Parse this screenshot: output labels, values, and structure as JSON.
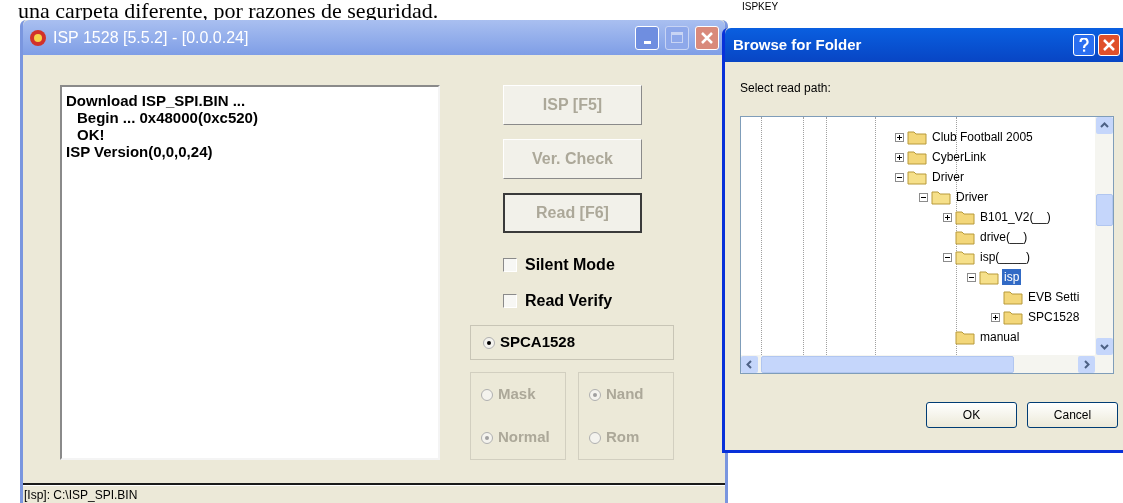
{
  "document_text": "una carpeta diferente, por razones de seguridad.",
  "desktop_label": "ISPKEY",
  "isp_window": {
    "title": "ISP 1528 [5.5.2] - [0.0.0.24]",
    "log_lines": [
      {
        "text": "Download ISP_SPI.BIN ...",
        "indented": false
      },
      {
        "text": "Begin ... 0x48000(0xc520)",
        "indented": true
      },
      {
        "text": "OK!",
        "indented": true
      },
      {
        "text": "ISP Version(0,0,0,24)",
        "indented": false
      }
    ],
    "buttons": [
      {
        "label": "ISP [F5]",
        "disabled": true,
        "default": false
      },
      {
        "label": "Ver. Check",
        "disabled": true,
        "default": false
      },
      {
        "label": "Read [F6]",
        "disabled": true,
        "default": true
      }
    ],
    "checkboxes": [
      {
        "label": "Silent Mode",
        "checked": false
      },
      {
        "label": "Read Verify",
        "checked": false
      }
    ],
    "chip_option": {
      "label": "SPCA1528",
      "selected": true
    },
    "radio_groups": [
      {
        "disabled": true,
        "options": [
          {
            "label": "Mask",
            "selected": false
          },
          {
            "label": "Normal",
            "selected": true
          }
        ]
      },
      {
        "disabled": true,
        "options": [
          {
            "label": "Nand",
            "selected": true
          },
          {
            "label": "Rom",
            "selected": false
          }
        ]
      }
    ],
    "status_bar": "[Isp]: C:\\ISP_SPI.BIN"
  },
  "browse_dialog": {
    "title": "Browse for Folder",
    "prompt": "Select read path:",
    "tree": [
      {
        "label": "Club Football 2005",
        "expanded": false,
        "selected": false
      },
      {
        "label": "CyberLink",
        "expanded": false,
        "selected": false
      },
      {
        "label": "Driver",
        "expanded": true,
        "selected": false,
        "children": [
          {
            "label": "Driver",
            "expanded": true,
            "selected": false,
            "children": [
              {
                "label": "B101_V2(__)",
                "expanded": false,
                "selected": false
              },
              {
                "label": "drive(__)",
                "selected": false
              },
              {
                "label": "isp(____)",
                "expanded": true,
                "selected": false,
                "children": [
                  {
                    "label": "isp",
                    "expanded": true,
                    "selected": true,
                    "children": [
                      {
                        "label": "EVB Setti",
                        "selected": false
                      },
                      {
                        "label": "SPC1528",
                        "expanded": false,
                        "selected": false
                      }
                    ]
                  }
                ]
              },
              {
                "label": "manual",
                "selected": false
              }
            ]
          }
        ]
      }
    ],
    "buttons": [
      "OK",
      "Cancel"
    ]
  }
}
